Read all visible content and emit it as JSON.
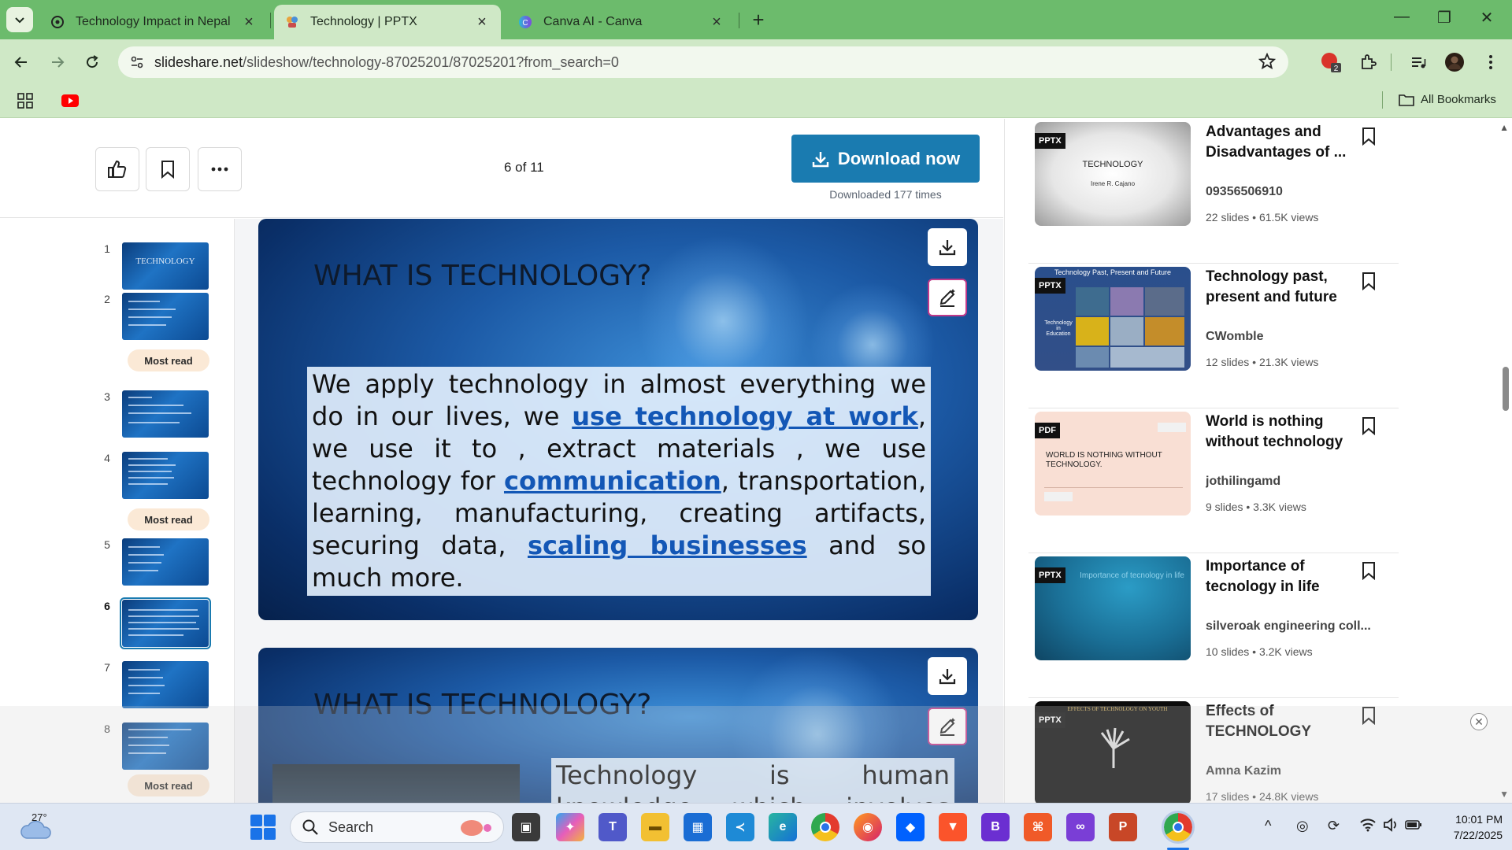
{
  "browser": {
    "tabs": [
      {
        "title": "Technology Impact in Nepal",
        "icon": "chatgpt-icon"
      },
      {
        "title": "Technology | PPTX",
        "icon": "slideshare-icon"
      },
      {
        "title": "Canva AI - Canva",
        "icon": "canva-icon"
      }
    ],
    "url_host": "slideshare.net",
    "url_path": "/slideshow/technology-87025201/87025201?from_search=0",
    "extension_badge": "2",
    "bookmarks_label": "All Bookmarks"
  },
  "viewer": {
    "page_indicator": "6 of 11",
    "download_label": "Download now",
    "downloaded_text": "Downloaded 177 times"
  },
  "thumbnails": [
    {
      "num": "1",
      "label": "TECHNOLOGY",
      "most_read": false,
      "current": false
    },
    {
      "num": "2",
      "label": "",
      "most_read": true,
      "current": false
    },
    {
      "num": "3",
      "label": "",
      "most_read": false,
      "current": false
    },
    {
      "num": "4",
      "label": "",
      "most_read": true,
      "current": false
    },
    {
      "num": "5",
      "label": "",
      "most_read": false,
      "current": false
    },
    {
      "num": "6",
      "label": "",
      "most_read": false,
      "current": true
    },
    {
      "num": "7",
      "label": "",
      "most_read": false,
      "current": false
    },
    {
      "num": "8",
      "label": "",
      "most_read": true,
      "current": false
    }
  ],
  "most_read_label": "Most read",
  "slides": [
    {
      "heading": "WHAT IS TECHNOLOGY?",
      "text_1": "We apply technology in almost everything we do in our lives, we ",
      "link_1": "use technology at work",
      "text_2": ", we use it to , extract materials , we use technology for ",
      "link_2": "communication",
      "text_3": ", transportation, learning, manufacturing, creating artifacts, securing data, ",
      "link_3": "scaling businesses",
      "text_4": " and so much more."
    },
    {
      "heading": "WHAT IS TECHNOLOGY?",
      "text_1": "Technology is human knowledge which involves tools, materials"
    }
  ],
  "related": [
    {
      "type": "PPTX",
      "title": "Advantages and Disadvantages of ...",
      "author": "09356506910",
      "slides": "22 slides",
      "views": "61.5K views",
      "thumb_title": "TECHNOLOGY",
      "thumb_sub": "Irene R. Cajano"
    },
    {
      "type": "PPTX",
      "title": "Technology past, present and future",
      "author": "CWomble",
      "slides": "12 slides",
      "views": "21.3K views",
      "thumb_title": "Technology Past, Present and Future",
      "thumb_sub": "Technology in Education"
    },
    {
      "type": "PDF",
      "title": "World is nothing without technology",
      "author": "jothilingamd",
      "slides": "9 slides",
      "views": "3.3K views",
      "thumb_title": "WORLD IS NOTHING WITHOUT TECHNOLOGY.",
      "thumb_sub": ""
    },
    {
      "type": "PPTX",
      "title": "Importance of tecnology in life",
      "author": "silveroak engineering coll...",
      "slides": "10 slides",
      "views": "3.2K views",
      "thumb_title": "Importance of tecnology in life",
      "thumb_sub": ""
    },
    {
      "type": "PPTX",
      "title": "Effects of TECHNOLOGY",
      "author": "Amna Kazim",
      "slides": "17 slides",
      "views": "24.8K views",
      "thumb_title": "EFFECTS OF TECHNOLOGY ON YOUTH",
      "thumb_sub": ""
    }
  ],
  "meta_separator": "•",
  "taskbar": {
    "temperature": "27°",
    "search_label": "Search",
    "time": "10:01 PM",
    "date": "7/22/2025"
  },
  "colors": {
    "tab_strip": "#6cbb6c",
    "toolbar": "#cfe8c6",
    "download_button": "#1a7bb0",
    "most_read_pill": "#fbe9d6"
  }
}
